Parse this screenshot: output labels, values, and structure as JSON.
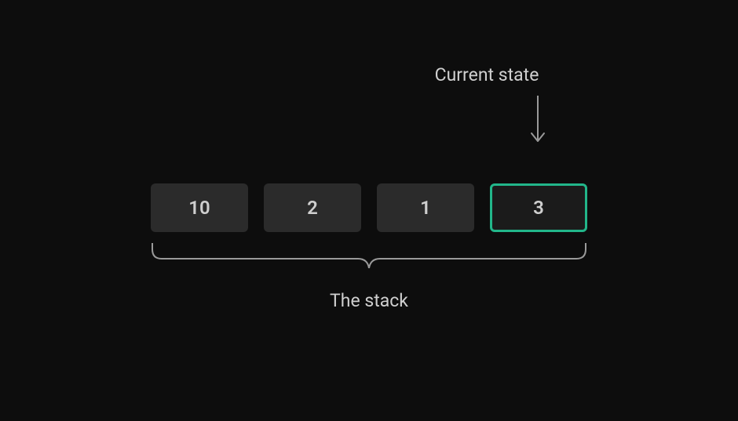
{
  "labels": {
    "current_state": "Current state",
    "the_stack": "The stack"
  },
  "stack": {
    "items": [
      "10",
      "2",
      "1",
      "3"
    ],
    "current_index": 3
  },
  "colors": {
    "background": "#0d0d0d",
    "cell": "#2b2b2b",
    "cell_current_border": "#22b68a",
    "text": "#cfcfcf",
    "annotation": "#9a9a9a"
  }
}
